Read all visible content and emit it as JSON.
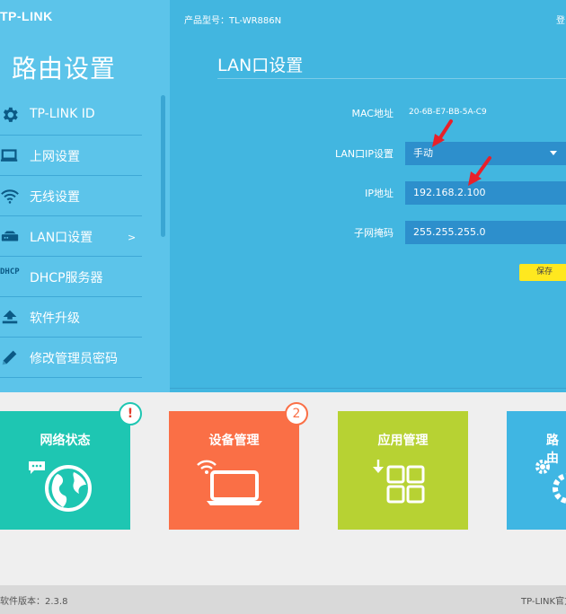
{
  "header": {
    "logo": "TP-LINK",
    "product_label": "产品型号：TL-WR886N",
    "login_label": "登"
  },
  "sidebar": {
    "title": "路由设置",
    "items": [
      {
        "label": "TP-LINK ID",
        "icon": "gear-icon"
      },
      {
        "label": "上网设置",
        "icon": "laptop-icon"
      },
      {
        "label": "无线设置",
        "icon": "wifi-icon"
      },
      {
        "label": "LAN口设置",
        "icon": "router-icon",
        "chevron": ">"
      },
      {
        "label": "DHCP服务器",
        "icon": "dhcp-icon",
        "icon_text": "DHCP"
      },
      {
        "label": "软件升级",
        "icon": "upload-icon"
      },
      {
        "label": "修改管理员密码",
        "icon": "pencil-icon"
      }
    ]
  },
  "main": {
    "title": "LAN口设置",
    "mac_label": "MAC地址",
    "mac_value": "20-6B-E7-BB-5A-C9",
    "lan_ip_label": "LAN口IP设置",
    "lan_ip_value": "手动",
    "ip_label": "IP地址",
    "ip_value": "192.168.2.100",
    "mask_label": "子网掩码",
    "mask_value": "255.255.255.0",
    "save_label": "保存"
  },
  "tiles": [
    {
      "label": "网络状态",
      "badge": "!",
      "color": "#1ec6b2",
      "icon": "globe-icon"
    },
    {
      "label": "设备管理",
      "badge": "2",
      "color": "#fa6f46",
      "icon": "laptop-wifi-icon"
    },
    {
      "label": "应用管理",
      "color": "#b7d233",
      "icon": "apps-icon"
    },
    {
      "label": "路由",
      "color": "#3fb6e3",
      "icon": "gears-icon"
    }
  ],
  "footer": {
    "version": "软件版本：2.3.8",
    "official": "TP-LINK官方"
  },
  "colors": {
    "top_bg": "#42b6e0",
    "sidebar_bg": "#5cc4ea",
    "field_bg": "#2d8fcc",
    "save_bg": "#ffe81f",
    "arrow": "#e8202a"
  }
}
